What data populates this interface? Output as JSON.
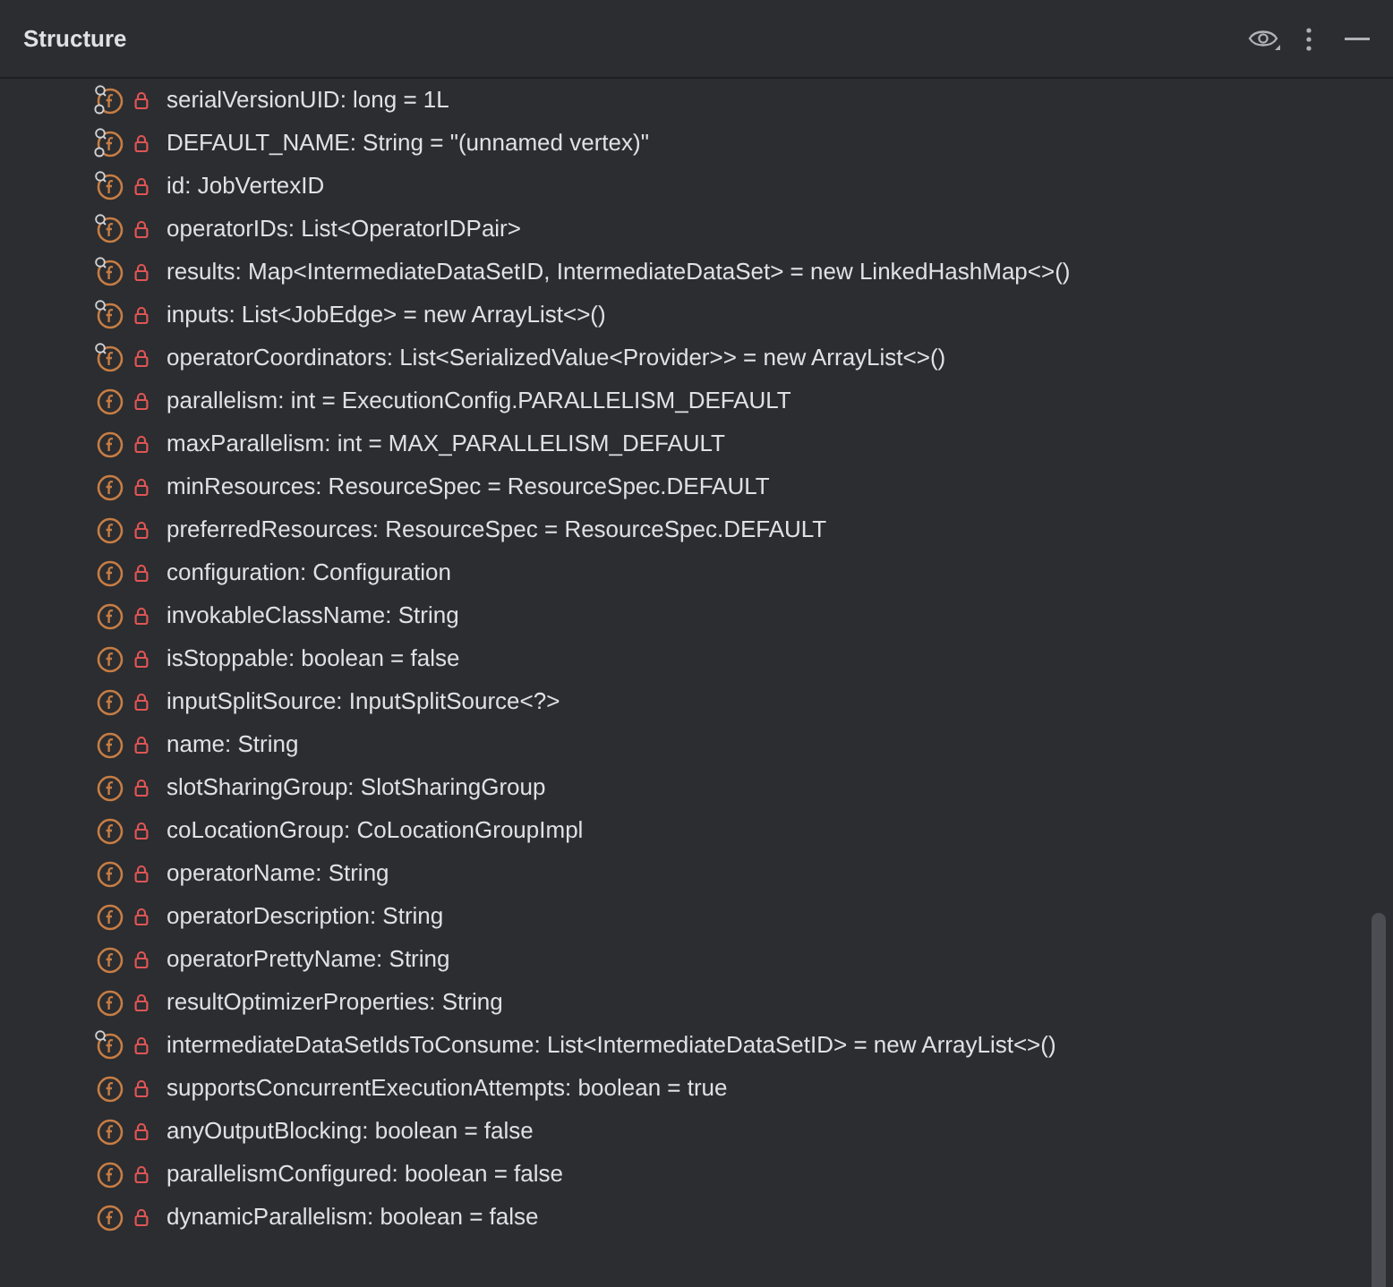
{
  "panel": {
    "title": "Structure"
  },
  "fields": [
    {
      "kind": "static_final",
      "text": "serialVersionUID: long = 1L"
    },
    {
      "kind": "static_final",
      "text": "DEFAULT_NAME: String = \"(unnamed vertex)\""
    },
    {
      "kind": "final",
      "text": "id: JobVertexID"
    },
    {
      "kind": "final",
      "text": "operatorIDs: List<OperatorIDPair>"
    },
    {
      "kind": "final",
      "text": "results: Map<IntermediateDataSetID, IntermediateDataSet> = new LinkedHashMap<>()"
    },
    {
      "kind": "final",
      "text": "inputs: List<JobEdge> = new ArrayList<>()"
    },
    {
      "kind": "final",
      "text": "operatorCoordinators: List<SerializedValue<Provider>> = new ArrayList<>()"
    },
    {
      "kind": "plain",
      "text": "parallelism: int = ExecutionConfig.PARALLELISM_DEFAULT"
    },
    {
      "kind": "plain",
      "text": "maxParallelism: int = MAX_PARALLELISM_DEFAULT"
    },
    {
      "kind": "plain",
      "text": "minResources: ResourceSpec = ResourceSpec.DEFAULT"
    },
    {
      "kind": "plain",
      "text": "preferredResources: ResourceSpec = ResourceSpec.DEFAULT"
    },
    {
      "kind": "plain",
      "text": "configuration: Configuration"
    },
    {
      "kind": "plain",
      "text": "invokableClassName: String"
    },
    {
      "kind": "plain",
      "text": "isStoppable: boolean = false"
    },
    {
      "kind": "plain",
      "text": "inputSplitSource: InputSplitSource<?>"
    },
    {
      "kind": "plain",
      "text": "name: String"
    },
    {
      "kind": "plain",
      "text": "slotSharingGroup: SlotSharingGroup"
    },
    {
      "kind": "plain",
      "text": "coLocationGroup: CoLocationGroupImpl"
    },
    {
      "kind": "plain",
      "text": "operatorName: String"
    },
    {
      "kind": "plain",
      "text": "operatorDescription: String"
    },
    {
      "kind": "plain",
      "text": "operatorPrettyName: String"
    },
    {
      "kind": "plain",
      "text": "resultOptimizerProperties: String"
    },
    {
      "kind": "final",
      "text": "intermediateDataSetIdsToConsume: List<IntermediateDataSetID> = new ArrayList<>()"
    },
    {
      "kind": "plain",
      "text": "supportsConcurrentExecutionAttempts: boolean = true"
    },
    {
      "kind": "plain",
      "text": "anyOutputBlocking: boolean = false"
    },
    {
      "kind": "plain",
      "text": "parallelismConfigured: boolean = false"
    },
    {
      "kind": "plain",
      "text": "dynamicParallelism: boolean = false"
    }
  ]
}
